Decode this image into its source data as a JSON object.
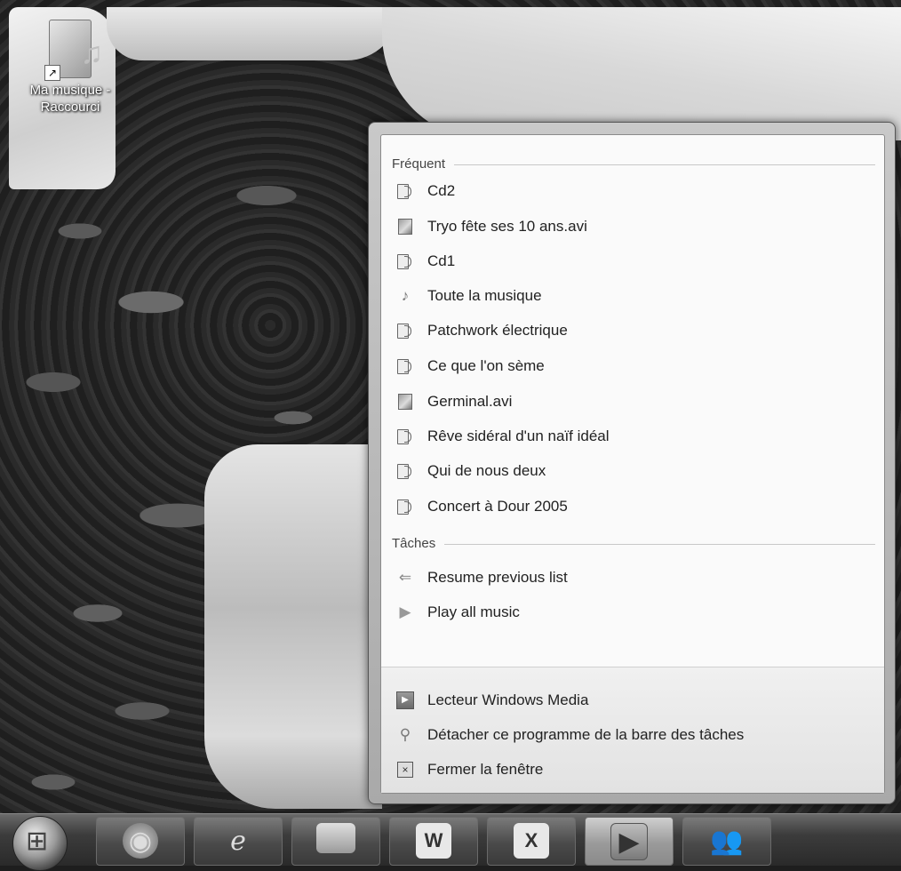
{
  "desktop": {
    "shortcut_label_line1": "Ma musique -",
    "shortcut_label_line2": "Raccourci"
  },
  "jumplist": {
    "frequent_header": "Fréquent",
    "frequent_items": [
      {
        "label": "Cd2",
        "icon": "album-icon"
      },
      {
        "label": "Tryo fête ses 10 ans.avi",
        "icon": "video-file-icon"
      },
      {
        "label": "Cd1",
        "icon": "album-icon"
      },
      {
        "label": "Toute la musique",
        "icon": "music-note-icon"
      },
      {
        "label": "Patchwork électrique",
        "icon": "album-icon"
      },
      {
        "label": "Ce que l'on sème",
        "icon": "album-icon"
      },
      {
        "label": "Germinal.avi",
        "icon": "video-file-icon"
      },
      {
        "label": "Rêve sidéral d'un naïf idéal",
        "icon": "album-icon"
      },
      {
        "label": "Qui de nous deux",
        "icon": "album-icon"
      },
      {
        "label": "Concert à Dour 2005",
        "icon": "album-icon"
      }
    ],
    "tasks_header": "Tâches",
    "tasks": [
      {
        "label": "Resume previous list",
        "icon": "arrow-left-icon"
      },
      {
        "label": "Play all music",
        "icon": "play-icon"
      }
    ],
    "bottom": [
      {
        "label": "Lecteur Windows Media",
        "icon": "windows-media-player-icon"
      },
      {
        "label": "Détacher ce programme de la barre des tâches",
        "icon": "unpin-icon"
      },
      {
        "label": "Fermer la fenêtre",
        "icon": "close-window-icon"
      }
    ]
  },
  "taskbar": {
    "buttons": [
      "firefox",
      "internet-explorer",
      "windows-explorer",
      "word",
      "excel",
      "windows-media-player",
      "windows-live-messenger"
    ],
    "active": "windows-media-player"
  }
}
